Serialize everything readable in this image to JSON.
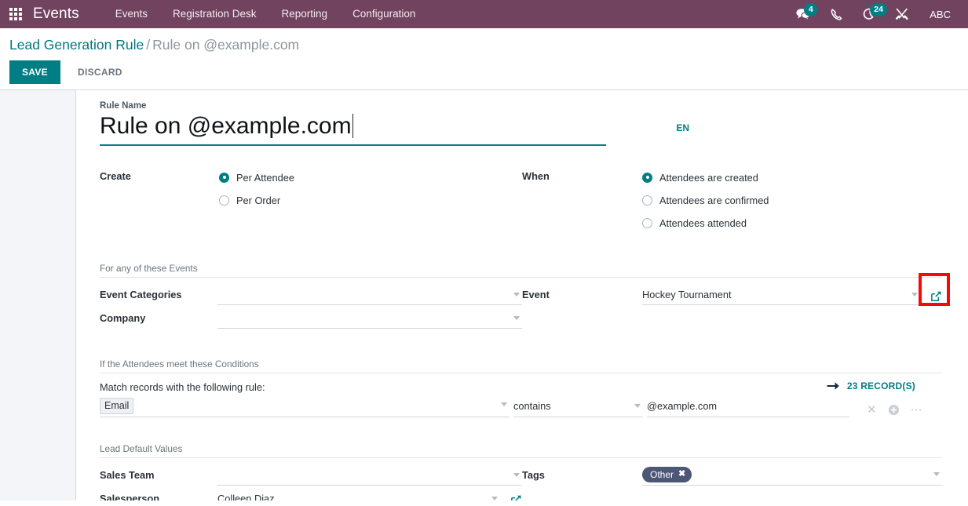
{
  "navbar": {
    "apps_icon": "apps-grid-icon",
    "brand": "Events",
    "menu": [
      {
        "label": "Events"
      },
      {
        "label": "Registration Desk"
      },
      {
        "label": "Reporting"
      },
      {
        "label": "Configuration"
      }
    ],
    "messages_icon": "chat-bubbles-icon",
    "messages_count": "4",
    "phone_icon": "phone-icon",
    "activities_icon": "crescent-moon-icon",
    "activities_count": "24",
    "tools_icon": "wrench-screwdriver-icon",
    "user": "ABC"
  },
  "control_panel": {
    "breadcrumb_root": "Lead Generation Rule",
    "breadcrumb_separator": "/",
    "breadcrumb_current": "Rule on @example.com",
    "save_label": "SAVE",
    "discard_label": "DISCARD"
  },
  "form": {
    "title_label": "Rule Name",
    "title_value": "Rule on @example.com",
    "lang_badge": "EN",
    "create": {
      "label": "Create",
      "options": [
        {
          "label": "Per Attendee",
          "selected": true
        },
        {
          "label": "Per Order",
          "selected": false
        }
      ]
    },
    "when": {
      "label": "When",
      "options": [
        {
          "label": "Attendees are created",
          "selected": true
        },
        {
          "label": "Attendees are confirmed",
          "selected": false
        },
        {
          "label": "Attendees attended",
          "selected": false
        }
      ]
    },
    "events_section": {
      "title": "For any of these Events",
      "event_categories_label": "Event Categories",
      "event_categories_value": "",
      "company_label": "Company",
      "company_value": "",
      "event_label": "Event",
      "event_value": "Hockey Tournament",
      "event_external_link_icon": "external-link-icon"
    },
    "conditions_section": {
      "title": "If the Attendees meet these Conditions",
      "match_text": "Match records with the following rule:",
      "records_arrow_icon": "arrow-right-icon",
      "records_label": "23 RECORD(S)",
      "field": "Email",
      "operator": "contains",
      "value": "@example.com",
      "remove_icon": "remove-x-icon",
      "add_icon": "add-circle-icon",
      "more_icon": "more-options-icon"
    },
    "defaults_section": {
      "title": "Lead Default Values",
      "sales_team_label": "Sales Team",
      "sales_team_value": "",
      "salesperson_label": "Salesperson",
      "salesperson_value": "Colleen Diaz",
      "salesperson_external_link_icon": "external-link-icon",
      "tags_label": "Tags",
      "tags": [
        {
          "label": "Other"
        }
      ]
    }
  },
  "annotation": {
    "highlight_color": "#f50a0a",
    "target": "event-external-link-icon"
  },
  "colors": {
    "navbar": "#71435f",
    "accent": "#017e84",
    "tag": "#4c5675"
  }
}
